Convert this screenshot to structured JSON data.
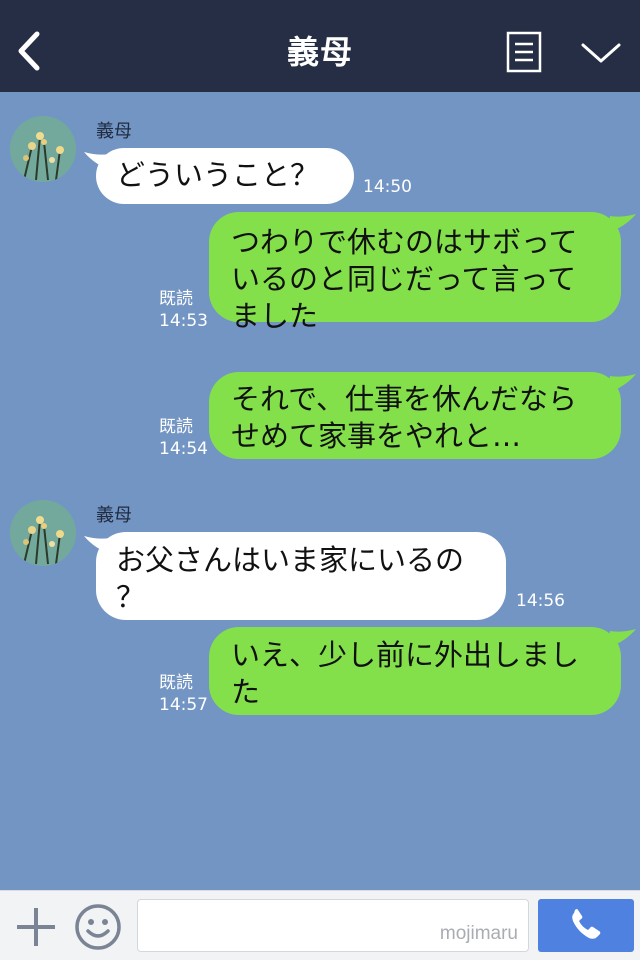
{
  "header": {
    "title": "義母",
    "icons": [
      "chevron-left-icon",
      "list-icon",
      "chevron-down-icon"
    ]
  },
  "messages": [
    {
      "sender": "義母",
      "lines": [
        "どういうこと？"
      ],
      "time": "14:50",
      "direction": "incoming"
    },
    {
      "lines": [
        "つわりで休むのはサボって",
        "いるのと同じだって言って",
        "ました"
      ],
      "status": "既読",
      "time": "14:53",
      "direction": "outgoing"
    },
    {
      "lines": [
        "それで、仕事を休んだなら",
        "せめて家事をやれと…"
      ],
      "status": "既読",
      "time": "14:54",
      "direction": "outgoing"
    },
    {
      "sender": "義母",
      "lines": [
        "お父さんはいま家にいるの",
        "？"
      ],
      "time": "14:56",
      "direction": "incoming"
    },
    {
      "lines": [
        "いえ、少し前に外出しまし",
        "た"
      ],
      "status": "既読",
      "time": "14:57",
      "direction": "outgoing"
    }
  ],
  "footer": {
    "input_value": "",
    "watermark": "mojimaru",
    "icons": [
      "plus-icon",
      "smiley-icon",
      "phone-icon"
    ]
  },
  "colors": {
    "header_bg": "#252e45",
    "chat_bg": "#7395c4",
    "incoming_bubble": "#ffffff",
    "outgoing_bubble": "#84e04a",
    "send_button": "#4f82e0"
  }
}
